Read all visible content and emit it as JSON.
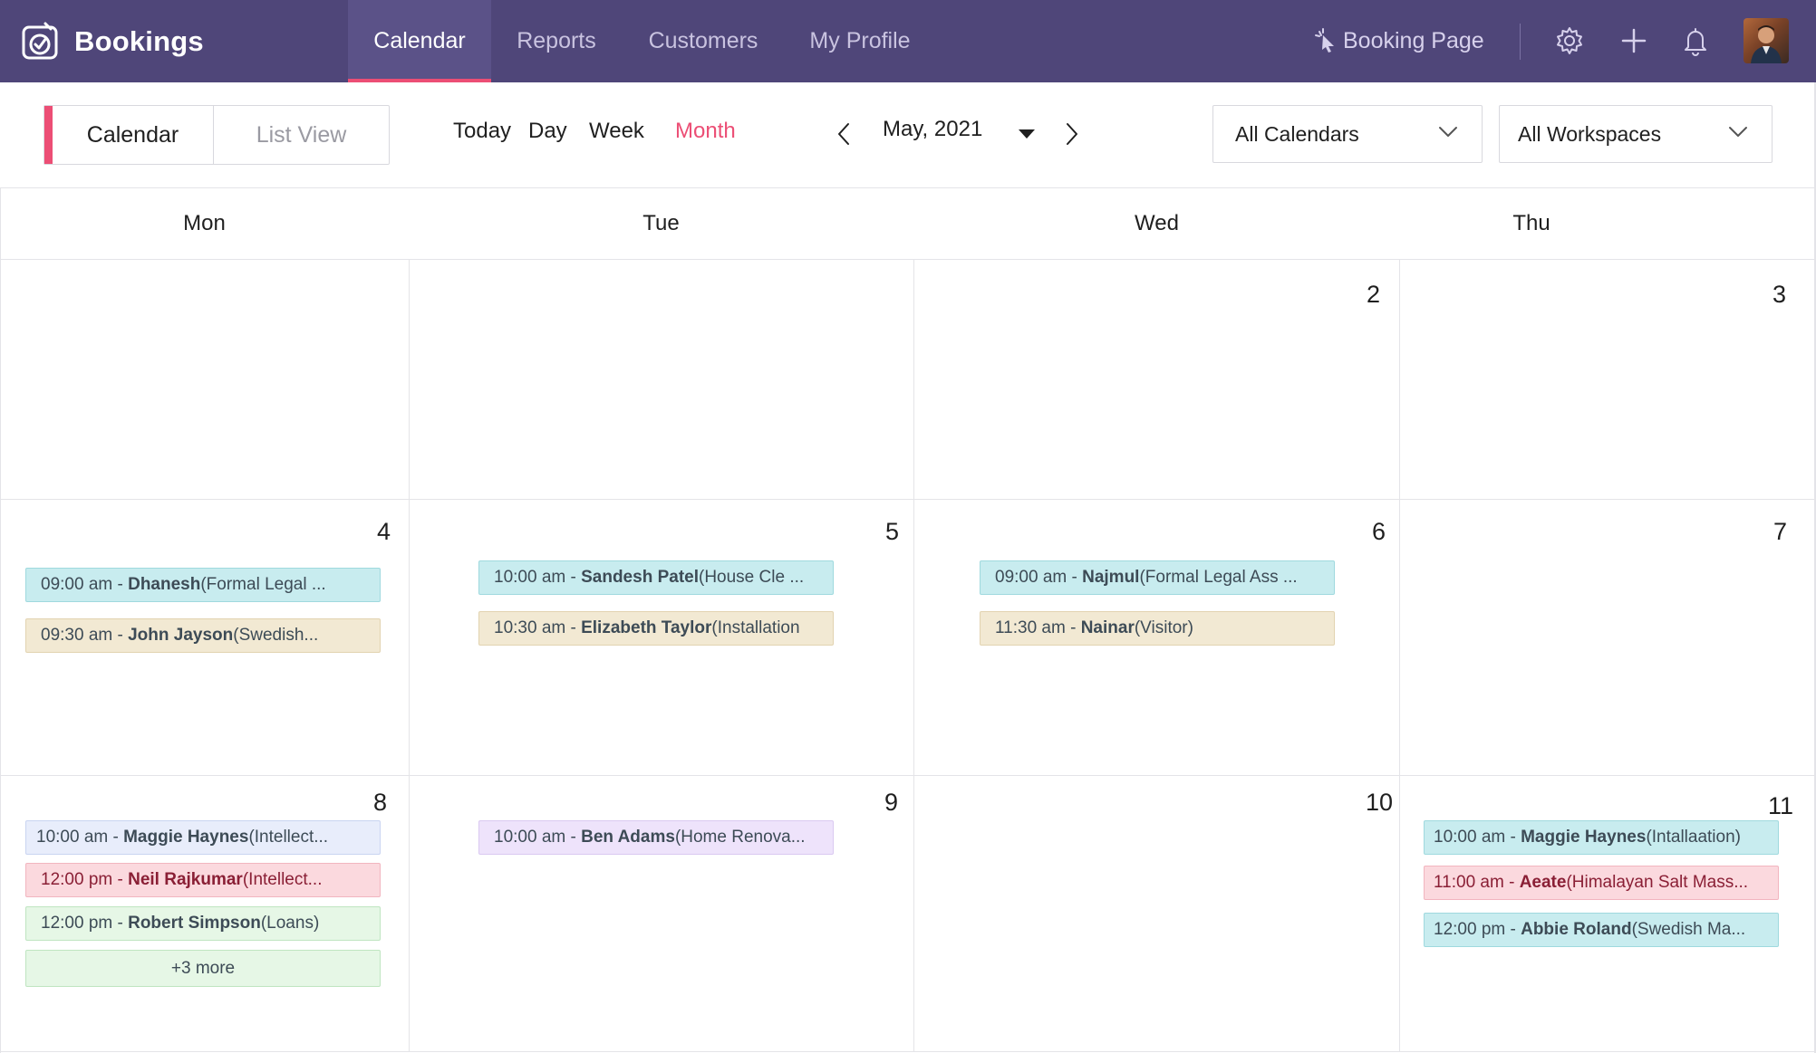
{
  "app": {
    "name": "Bookings"
  },
  "nav": {
    "tabs": [
      {
        "label": "Calendar",
        "active": true
      },
      {
        "label": "Reports",
        "active": false
      },
      {
        "label": "Customers",
        "active": false
      },
      {
        "label": "My Profile",
        "active": false
      }
    ],
    "booking_page_label": "Booking Page",
    "icons": [
      "settings-icon",
      "plus-icon",
      "bell-icon"
    ]
  },
  "toolbar": {
    "views": [
      "Calendar",
      "List View"
    ],
    "active_view": "Calendar",
    "ranges": [
      "Today",
      "Day",
      "Week",
      "Month"
    ],
    "active_range": "Month",
    "month_label": "May, 2021",
    "calendars_select": "All Calendars",
    "workspaces_select": "All Workspaces"
  },
  "calendar": {
    "weekdays": [
      "Mon",
      "Tue",
      "Wed",
      "Thu"
    ],
    "weeks": [
      {
        "days": [
          {
            "date": "",
            "events": []
          },
          {
            "date": "",
            "events": []
          },
          {
            "date": "2",
            "events": []
          },
          {
            "date": "3",
            "events": []
          }
        ]
      },
      {
        "days": [
          {
            "date": "4",
            "events": [
              {
                "time": "09:00 am - ",
                "name": "Dhanesh",
                "detail": " (Formal Legal ...",
                "color": "teal"
              },
              {
                "time": "09:30 am - ",
                "name": "John Jayson",
                "detail": " (Swedish...",
                "color": "tan"
              }
            ]
          },
          {
            "date": "5",
            "events": [
              {
                "time": "10:00 am - ",
                "name": "Sandesh Patel",
                "detail": " (House Cle ...",
                "color": "teal"
              },
              {
                "time": "10:30 am - ",
                "name": "Elizabeth Taylor",
                "detail": " (Installation",
                "color": "tan"
              }
            ]
          },
          {
            "date": "6",
            "events": [
              {
                "time": "09:00 am - ",
                "name": "Najmul",
                "detail": "  (Formal Legal Ass ...",
                "color": "teal"
              },
              {
                "time": "11:30 am - ",
                "name": "Nainar",
                "detail": "  (Visitor)",
                "color": "tan"
              }
            ]
          },
          {
            "date": "7",
            "events": []
          }
        ]
      },
      {
        "days": [
          {
            "date": "8",
            "events": [
              {
                "time": "10:00 am - ",
                "name": "Maggie Haynes",
                "detail": " (Intellect...",
                "color": "blue"
              },
              {
                "time": "12:00 pm - ",
                "name": "Neil Rajkumar",
                "detail": " (Intellect...",
                "color": "pink"
              },
              {
                "time": "12:00 pm - ",
                "name": "Robert Simpson",
                "detail": " (Loans)",
                "color": "green"
              }
            ],
            "more_label": "+3 more"
          },
          {
            "date": "9",
            "events": [
              {
                "time": "10:00 am - ",
                "name": "Ben Adams",
                "detail": " (Home Renova...",
                "color": "violet"
              }
            ]
          },
          {
            "date": "10",
            "events": []
          },
          {
            "date": "11",
            "events": [
              {
                "time": "10:00 am - ",
                "name": "Maggie Haynes",
                "detail": " (Intallaation)",
                "color": "teal"
              },
              {
                "time": "11:00 am - ",
                "name": "Aeate",
                "detail": " (Himalayan Salt Mass...",
                "color": "pink"
              },
              {
                "time": "12:00 pm - ",
                "name": "Abbie Roland",
                "detail": " (Swedish Ma...",
                "color": "teal"
              }
            ]
          }
        ]
      }
    ]
  }
}
